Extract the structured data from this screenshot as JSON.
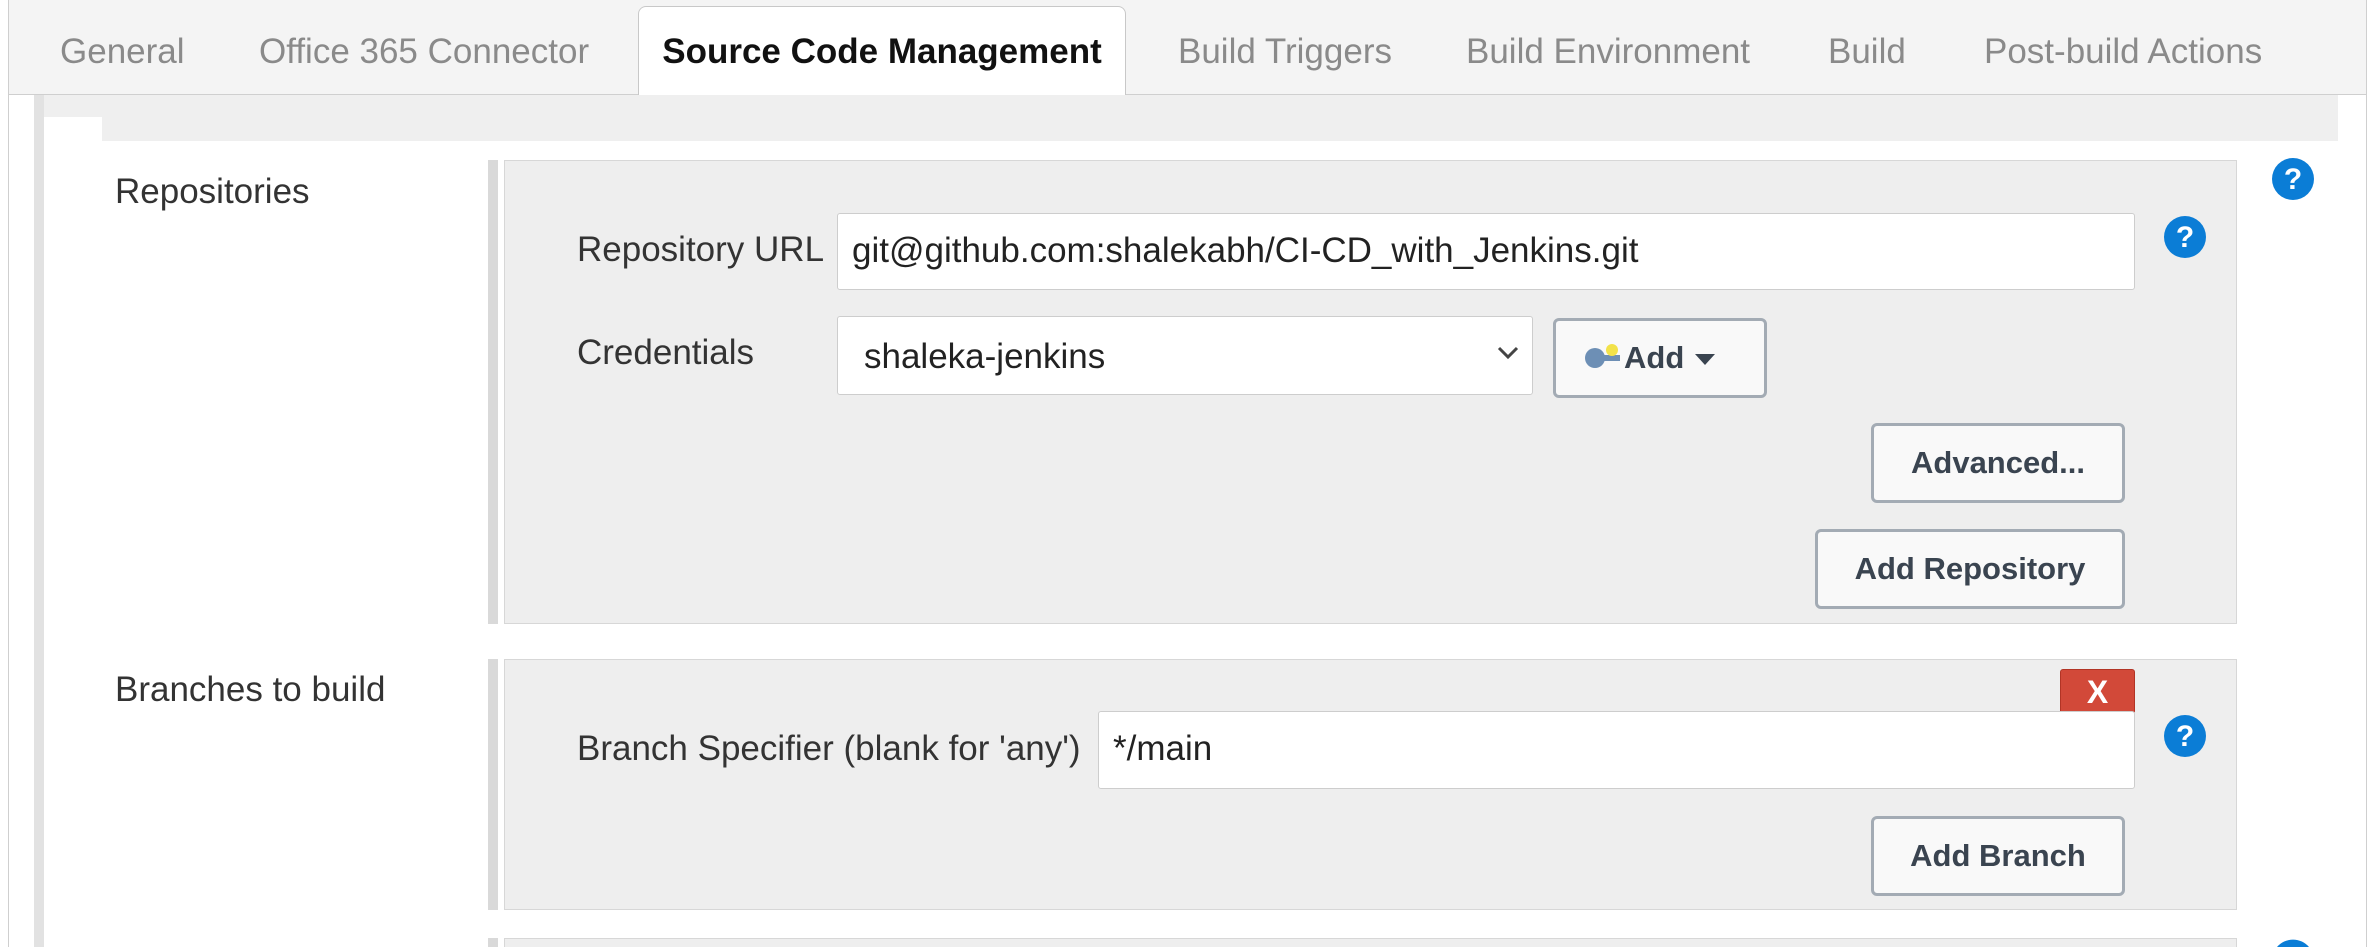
{
  "tabs": [
    {
      "label": "General"
    },
    {
      "label": "Office 365 Connector"
    },
    {
      "label": "Source Code Management"
    },
    {
      "label": "Build Triggers"
    },
    {
      "label": "Build Environment"
    },
    {
      "label": "Build"
    },
    {
      "label": "Post-build Actions"
    }
  ],
  "active_tab": "Source Code Management",
  "repositories": {
    "section_label": "Repositories",
    "url_label": "Repository URL",
    "url_value": "git@github.com:shalekabh/CI-CD_with_Jenkins.git",
    "credentials_label": "Credentials",
    "credentials_value": "shaleka-jenkins",
    "add_label": "Add",
    "advanced_label": "Advanced...",
    "add_repository_label": "Add Repository"
  },
  "branches": {
    "section_label": "Branches to build",
    "specifier_label": "Branch Specifier (blank for 'any')",
    "specifier_value": "*/main",
    "delete_label": "X",
    "add_branch_label": "Add Branch"
  },
  "help_symbol": "?",
  "colors": {
    "help_blue": "#0b7dd6",
    "delete_red": "#d24939",
    "button_border": "#a3abb4"
  }
}
